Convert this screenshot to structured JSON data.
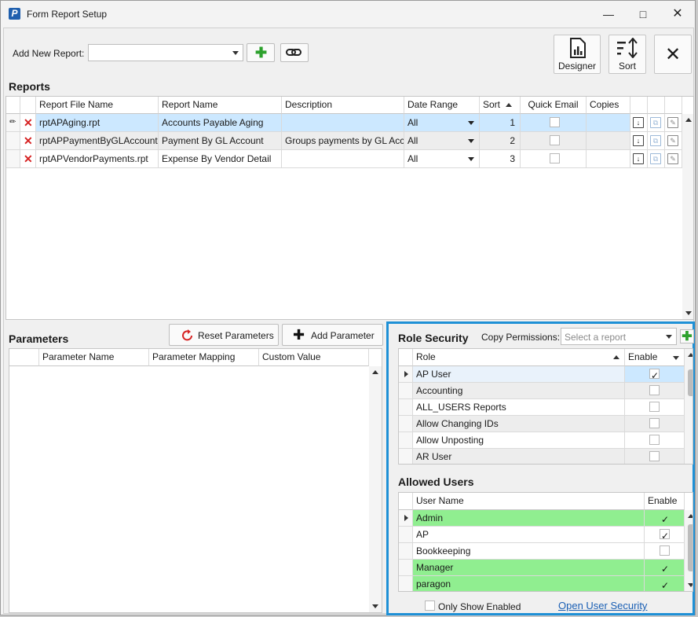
{
  "window": {
    "title": "Form Report Setup",
    "app_icon": "P"
  },
  "toolbar": {
    "add_new_report_label": "Add New Report:",
    "designer_label": "Designer",
    "sort_label": "Sort"
  },
  "reports": {
    "title": "Reports",
    "columns": [
      "Report File Name",
      "Report Name",
      "Description",
      "Date Range",
      "Sort",
      "Quick Email",
      "Copies"
    ],
    "rows": [
      {
        "file": "rptAPAging.rpt",
        "name": "Accounts Payable Aging",
        "description": "",
        "date_range": "All",
        "sort": "1",
        "copies": ""
      },
      {
        "file": "rptAPPaymentByGLAccount.",
        "name": "Payment By GL Account",
        "description": "Groups payments by GL Acc",
        "date_range": "All",
        "sort": "2",
        "copies": ""
      },
      {
        "file": "rptAPVendorPayments.rpt",
        "name": "Expense By Vendor Detail",
        "description": "",
        "date_range": "All",
        "sort": "3",
        "copies": ""
      }
    ]
  },
  "parameters": {
    "title": "Parameters",
    "reset_label": "Reset Parameters",
    "add_label": "Add Parameter",
    "columns": [
      "Parameter Name",
      "Parameter Mapping",
      "Custom Value"
    ]
  },
  "role_security": {
    "title": "Role Security",
    "copy_label": "Copy Permissions:",
    "copy_placeholder": "Select a report",
    "columns": [
      "Role",
      "Enable"
    ],
    "rows": [
      {
        "role": "AP User",
        "enabled": true
      },
      {
        "role": "Accounting",
        "enabled": false
      },
      {
        "role": "ALL_USERS Reports",
        "enabled": false
      },
      {
        "role": "Allow Changing IDs",
        "enabled": false
      },
      {
        "role": "Allow Unposting",
        "enabled": false
      },
      {
        "role": "AR User",
        "enabled": false
      }
    ]
  },
  "allowed_users": {
    "title": "Allowed Users",
    "columns": [
      "User Name",
      "Enable"
    ],
    "rows": [
      {
        "user": "Admin",
        "enabled": true
      },
      {
        "user": "AP",
        "enabled": true
      },
      {
        "user": "Bookkeeping",
        "enabled": false
      },
      {
        "user": "Manager",
        "enabled": true
      },
      {
        "user": "paragon",
        "enabled": true
      }
    ],
    "only_show_enabled_label": "Only Show Enabled",
    "open_user_security_label": "Open User Security"
  },
  "colors": {
    "highlight": "#1e90d6",
    "green_row": "#90ee90",
    "selected_row": "#cce8ff"
  }
}
